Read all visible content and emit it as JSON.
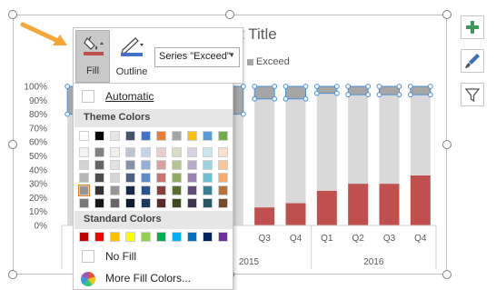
{
  "chart": {
    "title": "Chart Title",
    "legend_label": "Exceed"
  },
  "chart_data": {
    "type": "bar",
    "stacked": "100%",
    "categories": [
      "Q1",
      "Q2",
      "Q3",
      "Q4",
      "Q1",
      "Q2",
      "Q3",
      "Q4",
      "Q1",
      "Q2",
      "Q3",
      "Q4"
    ],
    "groups": [
      "2015",
      "2016"
    ],
    "series": [
      {
        "name": "",
        "color": "#c0504d",
        "values": [
          0,
          0,
          0,
          0,
          0,
          0,
          13,
          16,
          25,
          30,
          30,
          36
        ]
      },
      {
        "name": "",
        "color": "#d9d9d9",
        "values": [
          80,
          80,
          80,
          80,
          80,
          80,
          78,
          75,
          70,
          64,
          64,
          58
        ]
      },
      {
        "name": "Exceed",
        "color": "#a6a6a6",
        "values": [
          20,
          20,
          20,
          20,
          20,
          20,
          9,
          9,
          5,
          6,
          6,
          6
        ]
      }
    ],
    "visible_category_labels": [
      "Q1",
      "",
      "",
      "Q2",
      "Q3",
      "Q4",
      "Q1",
      "Q2",
      "Q3",
      "Q4"
    ],
    "yticks": [
      "0%",
      "10%",
      "20%",
      "30%",
      "40%",
      "50%",
      "60%",
      "70%",
      "80%",
      "90%",
      "100%"
    ],
    "ylim": [
      0,
      100
    ]
  },
  "toolbar": {
    "fill_label": "Fill",
    "outline_label": "Outline",
    "series_select_value": "Series \"Exceed\""
  },
  "fill_menu": {
    "automatic": "Automatic",
    "theme_colors_header": "Theme Colors",
    "standard_colors_header": "Standard Colors",
    "no_fill": "No Fill",
    "more_colors": "More Fill Colors...",
    "theme_top_row": [
      "#ffffff",
      "#000000",
      "#e7e6e6",
      "#44546a",
      "#4472c4",
      "#ed7d31",
      "#a5a5a5",
      "#ffc000",
      "#5b9bd5",
      "#70ad47"
    ],
    "theme_palette": [
      "#ffffff",
      "#000000",
      "#c9c9c9",
      "#1f3864",
      "#3a6fbd",
      "#c0504d",
      "#77933c",
      "#8064a2",
      "#4bacc6",
      "#f79646"
    ],
    "standard": [
      "#c00000",
      "#ff0000",
      "#ffc000",
      "#ffff00",
      "#92d050",
      "#00b050",
      "#00b0f0",
      "#0070c0",
      "#002060",
      "#7030a0"
    ]
  },
  "side_tools": [
    "plus-icon",
    "brush-icon",
    "filter-icon"
  ],
  "accent_color": "#f4a636"
}
